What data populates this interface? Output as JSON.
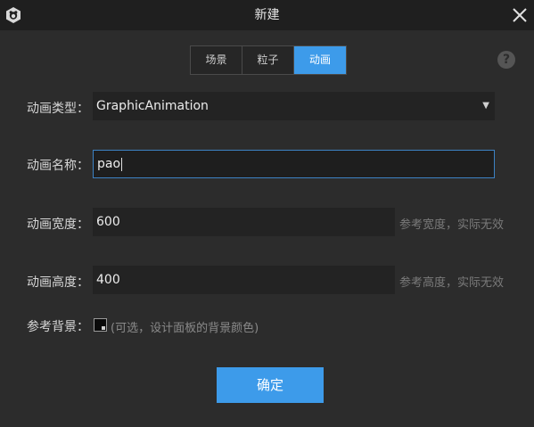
{
  "dialog": {
    "title": "新建"
  },
  "tabs": [
    {
      "label": "场景",
      "active": false
    },
    {
      "label": "粒子",
      "active": false
    },
    {
      "label": "动画",
      "active": true
    }
  ],
  "help": {
    "glyph": "?"
  },
  "form": {
    "type": {
      "label": "动画类型：",
      "value": "GraphicAnimation"
    },
    "name": {
      "label": "动画名称：",
      "value": "pao"
    },
    "width": {
      "label": "动画宽度：",
      "value": "600",
      "hint": "参考宽度，实际无效"
    },
    "height": {
      "label": "动画高度：",
      "value": "400",
      "hint": "参考高度，实际无效"
    },
    "background": {
      "label": "参考背景：",
      "hint": "(可选，设计面板的背景颜色)",
      "color": "#0a0a0a"
    }
  },
  "buttons": {
    "ok": "确定"
  },
  "colors": {
    "accent": "#3d9bea",
    "background": "#2c2c2c",
    "titlebar": "#1f1f1f"
  }
}
